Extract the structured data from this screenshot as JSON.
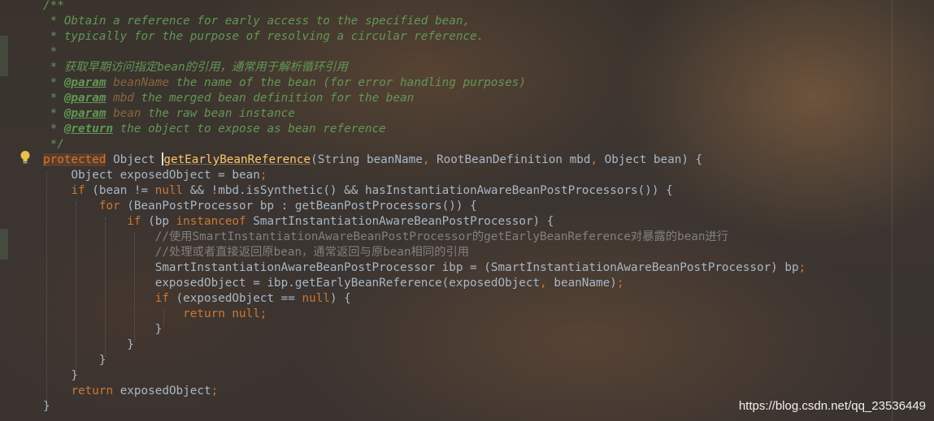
{
  "editor": {
    "lines": [
      [
        {
          "c": "cm",
          "t": "/**"
        }
      ],
      [
        {
          "c": "cm",
          "t": " * Obtain a reference for early access to the specified bean,"
        }
      ],
      [
        {
          "c": "cm",
          "t": " * typically for the purpose of resolving a circular reference."
        }
      ],
      [
        {
          "c": "cm",
          "t": " *"
        }
      ],
      [
        {
          "c": "cm",
          "t": " * 获取早期访问指定bean的引用，通常用于解析循环引用"
        }
      ],
      [
        {
          "c": "cm",
          "t": " * "
        },
        {
          "c": "tag",
          "t": "@param"
        },
        {
          "c": "cm",
          "t": " "
        },
        {
          "c": "pname",
          "t": "beanName"
        },
        {
          "c": "cm",
          "t": " the name of the bean (for error handling purposes)"
        }
      ],
      [
        {
          "c": "cm",
          "t": " * "
        },
        {
          "c": "tag",
          "t": "@param"
        },
        {
          "c": "cm",
          "t": " "
        },
        {
          "c": "pname",
          "t": "mbd"
        },
        {
          "c": "cm",
          "t": " the merged bean definition for the bean"
        }
      ],
      [
        {
          "c": "cm",
          "t": " * "
        },
        {
          "c": "tag",
          "t": "@param"
        },
        {
          "c": "cm",
          "t": " "
        },
        {
          "c": "pname",
          "t": "bean"
        },
        {
          "c": "cm",
          "t": " the raw bean instance"
        }
      ],
      [
        {
          "c": "cm",
          "t": " * "
        },
        {
          "c": "tag",
          "t": "@return"
        },
        {
          "c": "cm",
          "t": " the object to expose as bean reference"
        }
      ],
      [
        {
          "c": "cm",
          "t": " */"
        }
      ],
      [
        {
          "c": "kw hl-protected",
          "t": "protected"
        },
        {
          "c": "plain",
          "t": " Object "
        },
        {
          "c": "caret",
          "t": ""
        },
        {
          "c": "fn hl-fn",
          "t": "getEarlyBeanReference"
        },
        {
          "c": "plain",
          "t": "(String beanName"
        },
        {
          "c": "kw",
          "t": ","
        },
        {
          "c": "plain",
          "t": " RootBeanDefinition mbd"
        },
        {
          "c": "kw",
          "t": ","
        },
        {
          "c": "plain",
          "t": " Object bean) {"
        }
      ],
      [
        {
          "c": "plain",
          "t": "    Object exposedObject = bean"
        },
        {
          "c": "kw",
          "t": ";"
        }
      ],
      [
        {
          "c": "plain",
          "t": "    "
        },
        {
          "c": "kw",
          "t": "if"
        },
        {
          "c": "plain",
          "t": " (bean != "
        },
        {
          "c": "kw",
          "t": "null"
        },
        {
          "c": "plain",
          "t": " && !mbd.isSynthetic() && hasInstantiationAwareBeanPostProcessors()) {"
        }
      ],
      [
        {
          "c": "plain",
          "t": "        "
        },
        {
          "c": "kw",
          "t": "for"
        },
        {
          "c": "plain",
          "t": " (BeanPostProcessor bp : getBeanPostProcessors()) {"
        }
      ],
      [
        {
          "c": "plain",
          "t": "            "
        },
        {
          "c": "kw",
          "t": "if"
        },
        {
          "c": "plain",
          "t": " (bp "
        },
        {
          "c": "kw",
          "t": "instanceof"
        },
        {
          "c": "plain",
          "t": " SmartInstantiationAwareBeanPostProcessor) {"
        }
      ],
      [
        {
          "c": "plain",
          "t": "                "
        },
        {
          "c": "lc",
          "t": "//使用SmartInstantiationAwareBeanPostProcessor的getEarlyBeanReference对暴露的bean进行"
        }
      ],
      [
        {
          "c": "plain",
          "t": "                "
        },
        {
          "c": "lc",
          "t": "//处理或者直接返回原bean，通常返回与原bean相同的引用"
        }
      ],
      [
        {
          "c": "plain",
          "t": "                SmartInstantiationAwareBeanPostProcessor ibp = (SmartInstantiationAwareBeanPostProcessor) bp"
        },
        {
          "c": "kw",
          "t": ";"
        }
      ],
      [
        {
          "c": "plain",
          "t": "                exposedObject = ibp.getEarlyBeanReference(exposedObject"
        },
        {
          "c": "kw",
          "t": ","
        },
        {
          "c": "plain",
          "t": " beanName)"
        },
        {
          "c": "kw",
          "t": ";"
        }
      ],
      [
        {
          "c": "plain",
          "t": "                "
        },
        {
          "c": "kw",
          "t": "if"
        },
        {
          "c": "plain",
          "t": " (exposedObject == "
        },
        {
          "c": "kw",
          "t": "null"
        },
        {
          "c": "plain",
          "t": ") {"
        }
      ],
      [
        {
          "c": "plain",
          "t": "                    "
        },
        {
          "c": "kw",
          "t": "return null;"
        }
      ],
      [
        {
          "c": "plain",
          "t": "                }"
        }
      ],
      [
        {
          "c": "plain",
          "t": "            }"
        }
      ],
      [
        {
          "c": "plain",
          "t": "        }"
        }
      ],
      [
        {
          "c": "plain",
          "t": "    }"
        }
      ],
      [
        {
          "c": "plain",
          "t": "    "
        },
        {
          "c": "kw",
          "t": "return"
        },
        {
          "c": "plain",
          "t": " exposedObject"
        },
        {
          "c": "kw",
          "t": ";"
        }
      ],
      [
        {
          "c": "plain",
          "t": "}"
        }
      ]
    ]
  },
  "gutter": {
    "intention_icon": "lightbulb-icon"
  },
  "watermark": {
    "text": "https://blog.csdn.net/qq_23536449"
  }
}
